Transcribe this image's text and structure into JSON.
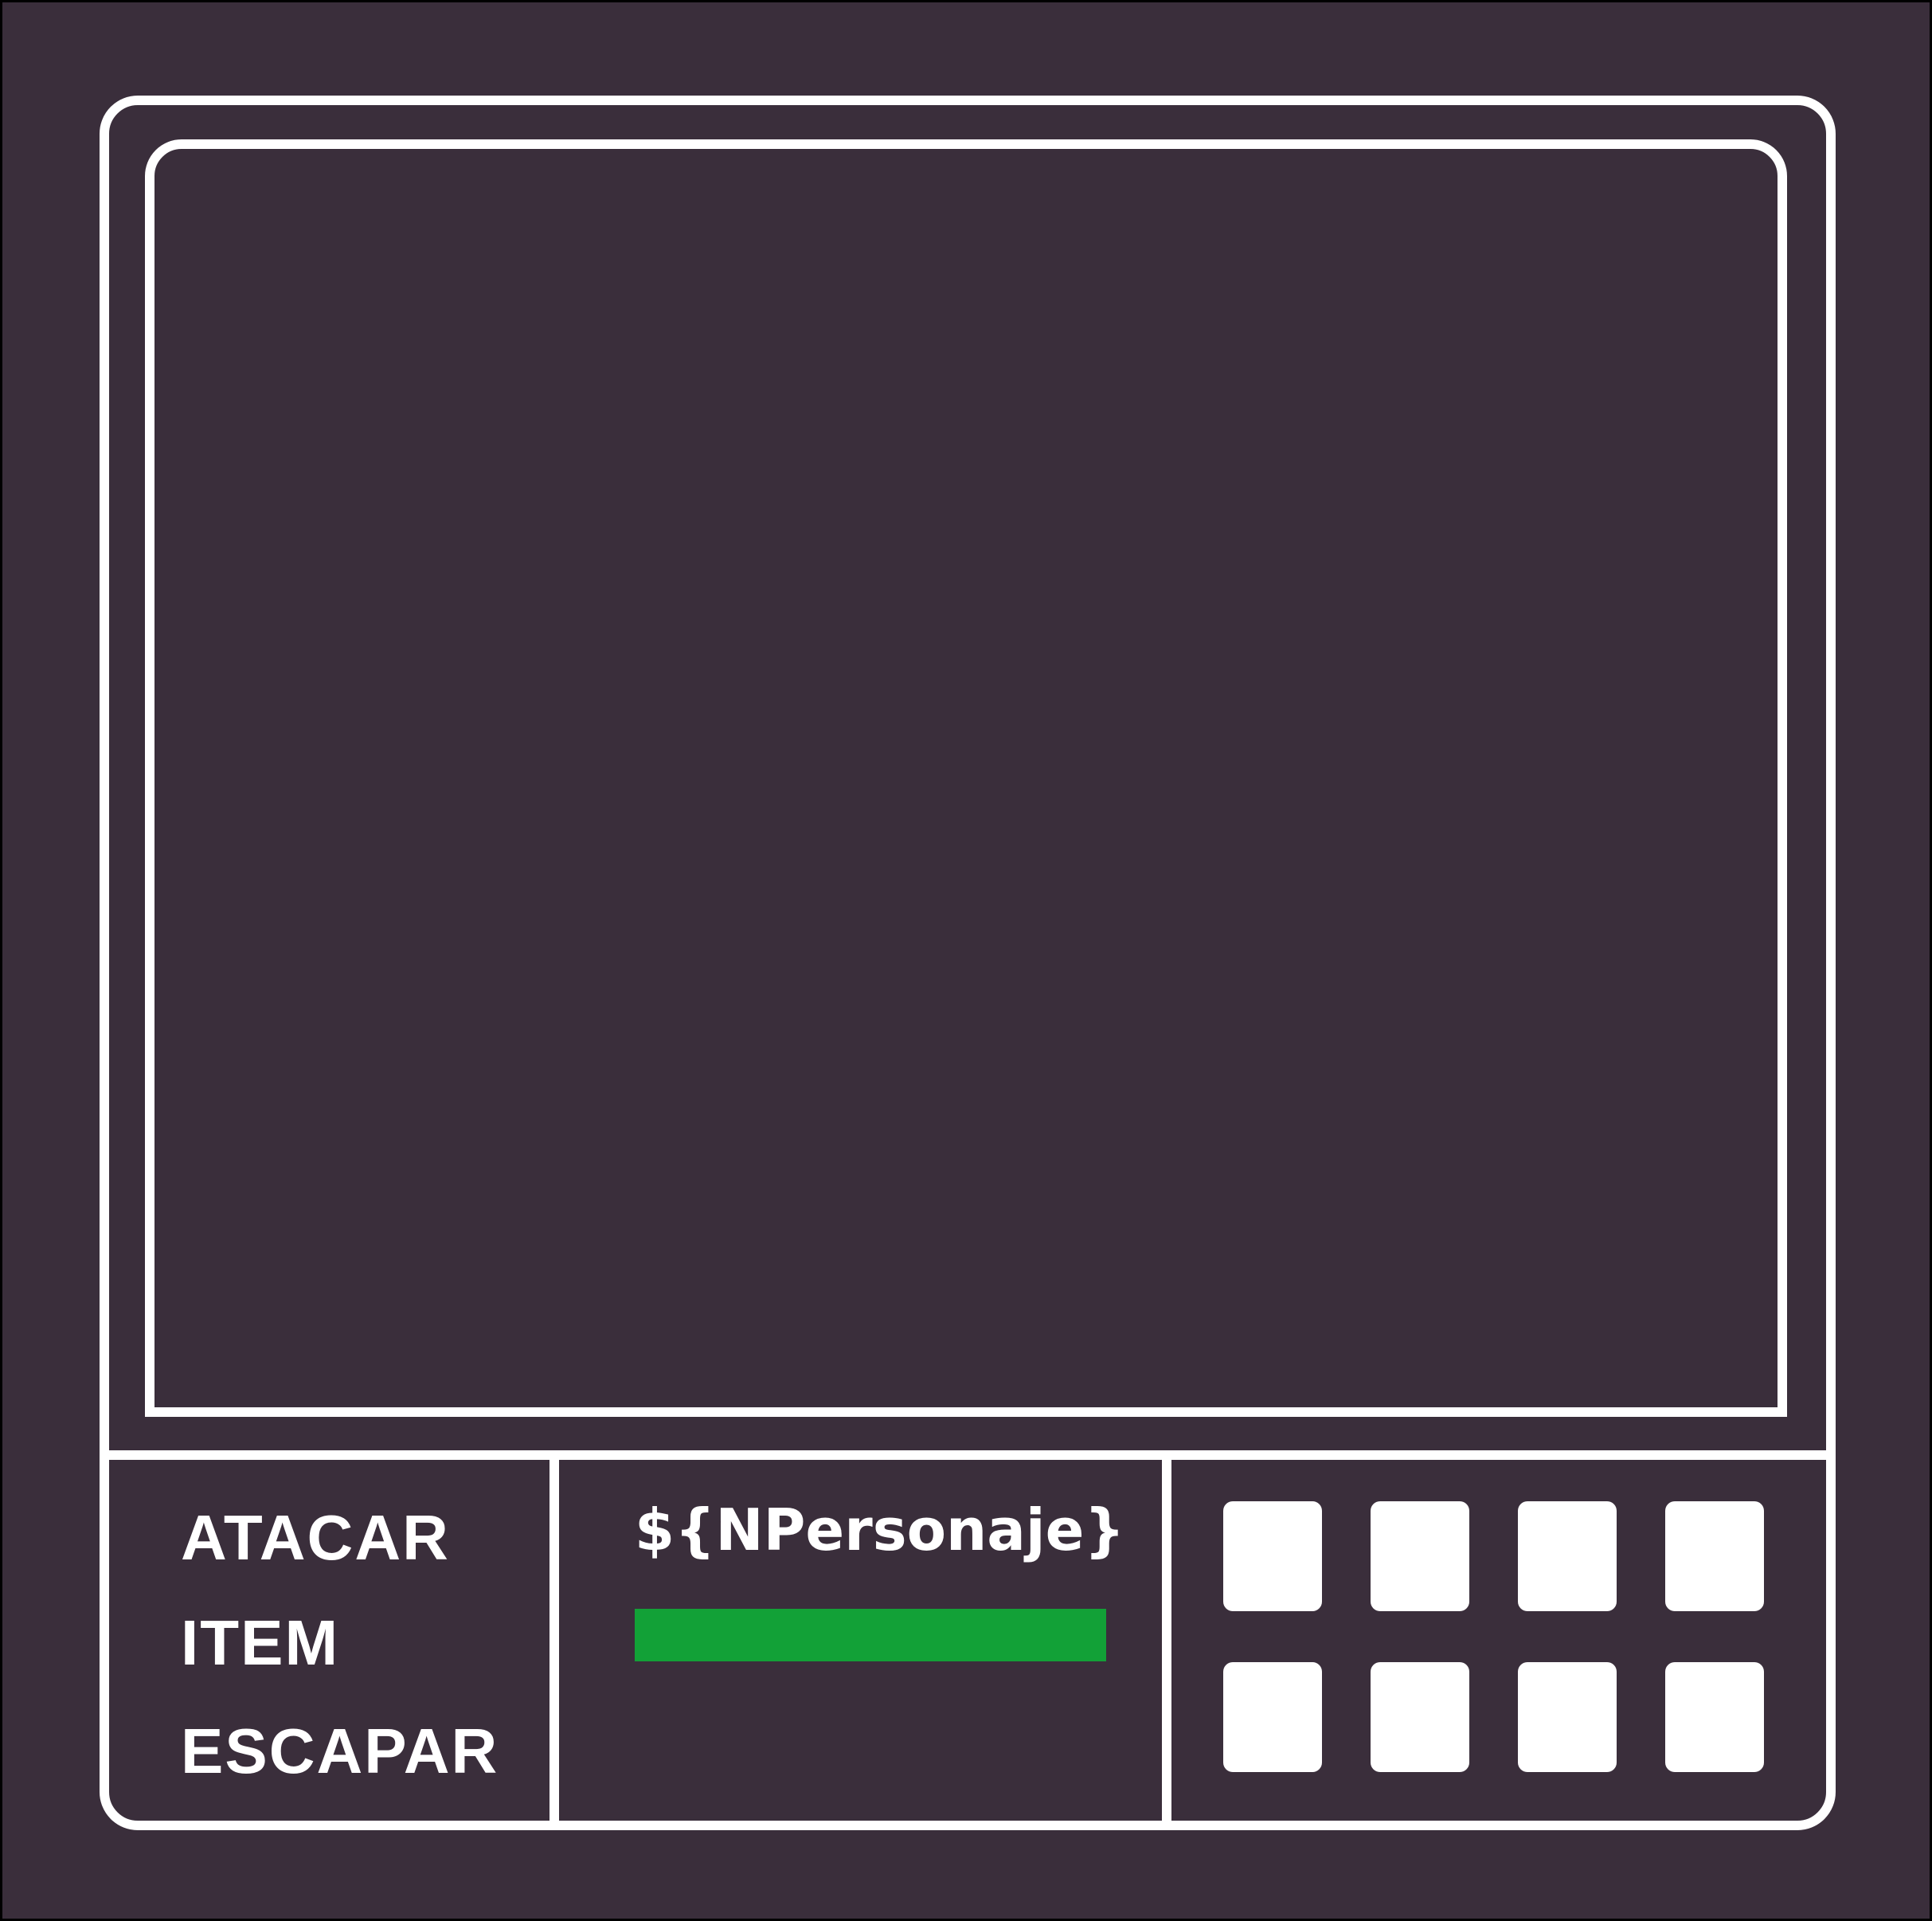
{
  "menu": {
    "attack": "ATACAR",
    "item": "ITEM",
    "escape": "ESCAPAR"
  },
  "status": {
    "character_name": "${NPersonaje}",
    "hp_fraction": 1.0,
    "hp_color": "#12a137"
  },
  "inventory": {
    "slot_count": 8
  },
  "colors": {
    "background": "#3a2e3b",
    "frame": "#ffffff"
  }
}
